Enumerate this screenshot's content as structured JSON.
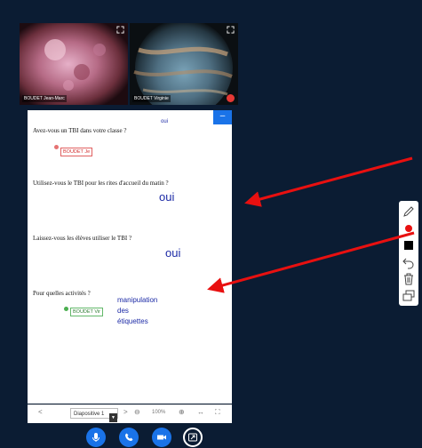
{
  "videos": [
    {
      "name": "BOUDET Jean-Marc"
    },
    {
      "name": "BOUDET Virginie"
    }
  ],
  "slide": {
    "top_answer": "oui",
    "questions": [
      {
        "text": "Avez-vous un TBI dans votre classe ?",
        "tag": "BOUDET Je"
      },
      {
        "text": "Utilisez-vous le TBI pour les rites d'accueil du matin ?",
        "answer": "oui"
      },
      {
        "text": "Laissez-vous les élèves utiliser le TBI ?",
        "answer": "oui"
      },
      {
        "text": "Pour quelles activités ?",
        "tag": "BOUDET Vir",
        "answer_lines": [
          "manipulation",
          "des",
          "étiquettes"
        ]
      }
    ]
  },
  "navbar": {
    "prev": "<",
    "slide_select": "Diapositive 1",
    "next": ">",
    "zoom_out": "⊖",
    "zoom_value": "100%",
    "zoom_in": "⊕",
    "fit_width": "↔",
    "fullscreen": "⛶"
  },
  "colors": {
    "background": "#0b1c33",
    "accent": "#1a73e8",
    "answer": "#1c2aa6",
    "arrow": "#e81010"
  },
  "controls": [
    "microphone-icon",
    "phone-hangup-icon",
    "camera-icon",
    "screen-share-icon"
  ],
  "tools": [
    "pencil-icon",
    "color-dot-icon",
    "stroke-square-icon",
    "undo-icon",
    "trash-icon",
    "multi-user-icon"
  ]
}
